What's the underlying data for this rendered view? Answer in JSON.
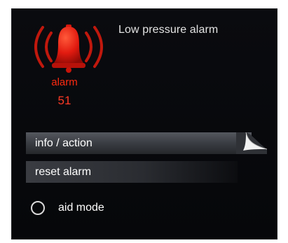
{
  "alarm": {
    "icon": "bell-alarm-icon",
    "title": "Low pressure alarm",
    "label": "alarm",
    "code": "51",
    "color": "#ff2a10"
  },
  "menu": {
    "info_action_label": "info / action",
    "reset_alarm_label": "reset alarm"
  },
  "aid_mode": {
    "label": "aid mode",
    "checked": false
  }
}
